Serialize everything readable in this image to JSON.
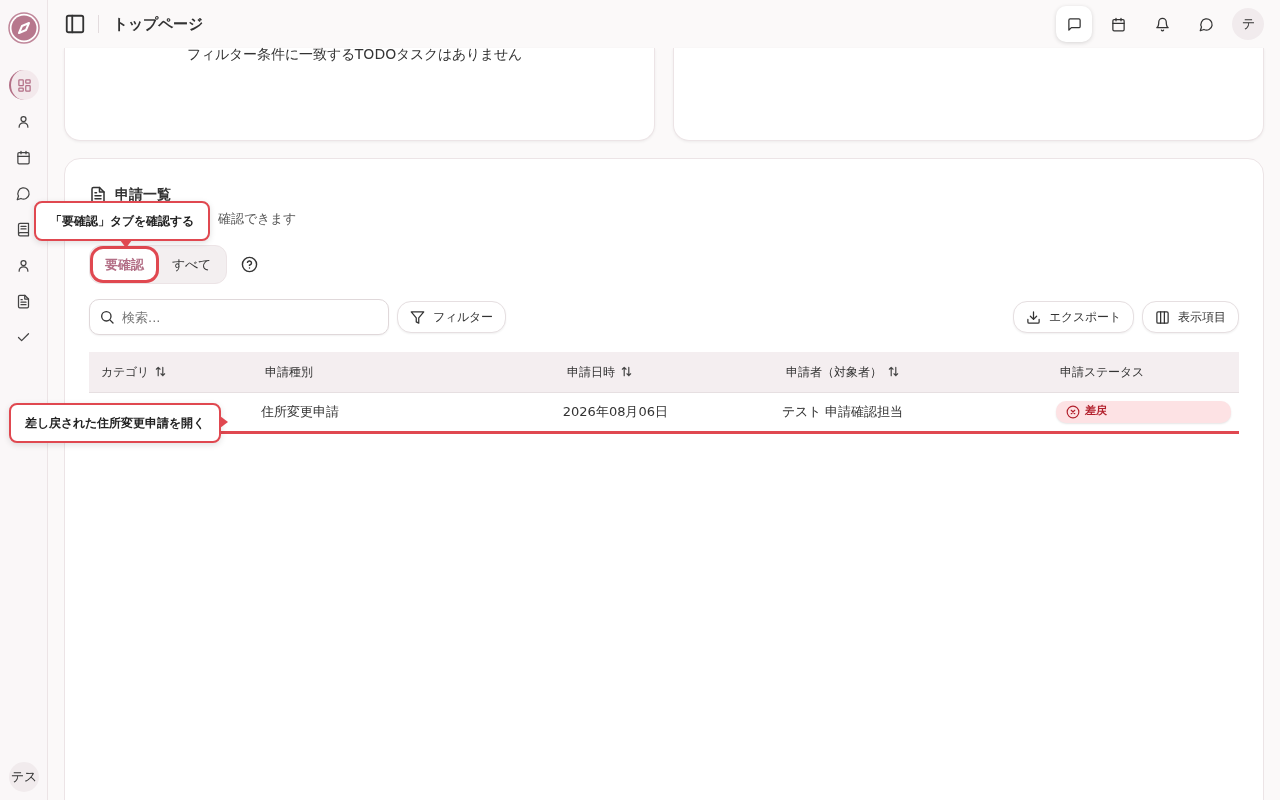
{
  "header": {
    "title": "トップページ",
    "actions": [
      {
        "kind": "message",
        "selected": true
      },
      {
        "kind": "calendar",
        "selected": false
      },
      {
        "kind": "bell",
        "selected": false
      },
      {
        "kind": "chat",
        "selected": false
      }
    ],
    "avatar": "テ"
  },
  "sidebar": {
    "items": [
      {
        "kind": "grid",
        "selected": true
      },
      {
        "kind": "user",
        "selected": false
      },
      {
        "kind": "calendar",
        "selected": false
      },
      {
        "kind": "chat",
        "selected": false
      },
      {
        "kind": "book",
        "selected": false
      },
      {
        "kind": "user",
        "selected": false
      },
      {
        "kind": "document",
        "selected": false
      },
      {
        "kind": "check",
        "selected": false
      }
    ],
    "avatar": "テス"
  },
  "todo_card": {
    "empty_message": "フィルター条件に一致するTODOタスクはありません"
  },
  "applications": {
    "title": "申請一覧",
    "subtitle": "確認できます",
    "tabs": [
      {
        "label": "要確認",
        "selected": true,
        "highlighted": true
      },
      {
        "label": "すべて",
        "selected": false,
        "highlighted": false
      }
    ],
    "search": {
      "placeholder": "検索..."
    },
    "filter_button": "フィルター",
    "export_button": "エクスポート",
    "columns_button": "表示項目",
    "table": {
      "columns": [
        {
          "label": "カテゴリ",
          "sortable": true
        },
        {
          "label": "申請種別",
          "sortable": false
        },
        {
          "label": "申請日時",
          "sortable": true
        },
        {
          "label": "申請者（対象者）",
          "sortable": true
        },
        {
          "label": "申請ステータス",
          "sortable": false
        }
      ],
      "rows": [
        {
          "type": "住所変更申請",
          "date": "2026年08月06日",
          "applicant": "テスト 申請確認担当",
          "status": "差戻",
          "highlighted": true
        }
      ]
    }
  },
  "tooltips": [
    {
      "text": "「要確認」タブを確認する",
      "kind": "above"
    },
    {
      "text": "差し戻された住所変更申請を開く",
      "kind": "left"
    }
  ]
}
